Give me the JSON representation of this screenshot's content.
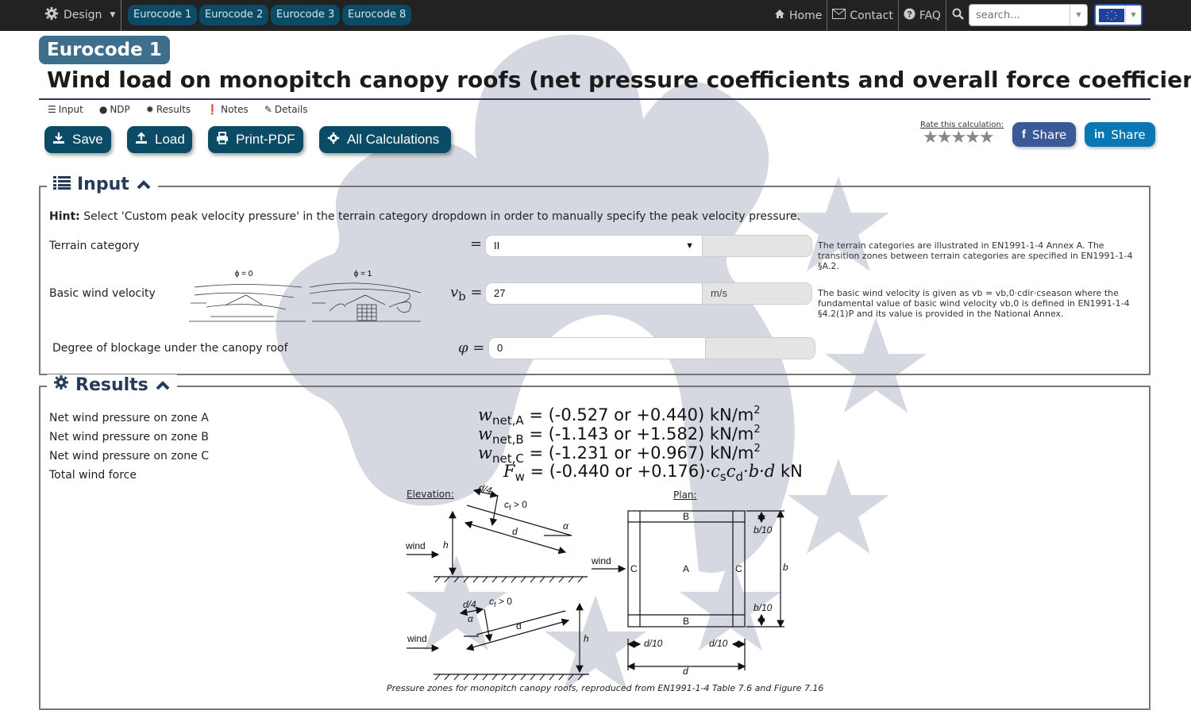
{
  "nav": {
    "design_label": "Design",
    "eurocodes": [
      "Eurocode 1",
      "Eurocode 2",
      "Eurocode 3",
      "Eurocode 8"
    ],
    "home": "Home",
    "contact": "Contact",
    "faq": "FAQ",
    "search_placeholder": "search...",
    "language": "EU"
  },
  "header": {
    "badge": "Eurocode 1",
    "title": "Wind load on monopitch canopy roofs (net pressure coefficients and overall force coefficient)",
    "subnav": [
      "Input",
      "NDP",
      "Results",
      "Notes",
      "Details"
    ]
  },
  "toolbar": {
    "save": "Save",
    "load": "Load",
    "print": "Print-PDF",
    "all_calcs": "All Calculations",
    "rate_label": "Rate this calculation:",
    "rating_stars": "★★★★★",
    "facebook_share": "Share",
    "linkedin_share": "Share",
    "colors": {
      "primary": "#0b4b66",
      "facebook": "#3b5998",
      "linkedin": "#0a77b5"
    }
  },
  "input": {
    "legend": "Input",
    "hint_bold": "Hint:",
    "hint_text": "Select 'Custom peak velocity pressure' in the terrain category dropdown in order to manually specify the peak velocity pressure.",
    "terrain": {
      "label": "Terrain category",
      "symbol": "=",
      "value": "II",
      "note": "The terrain categories are illustrated in EN1991-1-4 Annex A. The transition zones between terrain categories are specified in EN1991-1-4 §A.2."
    },
    "wind_velocity": {
      "label": "Basic wind velocity",
      "symbol_base": "v",
      "symbol_sub": "b",
      "eq": "=",
      "value": "27",
      "unit": "m/s",
      "note": "The basic wind velocity is given as vb = vb,0·cdir·cseason where the fundamental value of basic wind velocity vb,0 is defined in EN1991-1-4 §4.2(1)P and its value is provided in the National Annex."
    },
    "blockage": {
      "label": "Degree of blockage under the canopy roof",
      "symbol": "φ",
      "eq": "=",
      "value": "0"
    },
    "figure_phi0": "ϕ = 0",
    "figure_phi1": "ϕ = 1"
  },
  "results": {
    "legend": "Results",
    "rows": [
      {
        "label": "Net wind pressure on zone A",
        "sym": "w",
        "sub": "net,A",
        "value": " = (-0.527 or +0.440) kN/m",
        "sup": "2"
      },
      {
        "label": "Net wind pressure on zone B",
        "sym": "w",
        "sub": "net,B",
        "value": " = (-1.143 or +1.582) kN/m",
        "sup": "2"
      },
      {
        "label": "Net wind pressure on zone C",
        "sym": "w",
        "sub": "net,C",
        "value": " = (-1.231 or +0.967) kN/m",
        "sup": "2"
      },
      {
        "label": "Total wind force",
        "sym": "F",
        "sub": "w",
        "value": " = (-0.440 or +0.176)·",
        "tail": "c",
        "tail_sub1": "s",
        "tail2": "c",
        "tail_sub2": "d",
        "tail3": "·b·d",
        "unit": " kN"
      }
    ],
    "figure": {
      "elevation_label": "Elevation:",
      "plan_label": "Plan:",
      "wind": "wind",
      "h": "h",
      "d": "d",
      "d4": "d/4",
      "cf": "c",
      "cf_sub": "f",
      "cf_cond": " > 0",
      "alpha": "α",
      "zone_a": "A",
      "zone_b": "B",
      "zone_c": "C",
      "b": "b",
      "b10": "b/10",
      "d10": "d/10"
    },
    "caption": "Pressure zones for monopitch canopy roofs, reproduced from EN1991-1-4 Table 7.6 and Figure 7.16"
  }
}
